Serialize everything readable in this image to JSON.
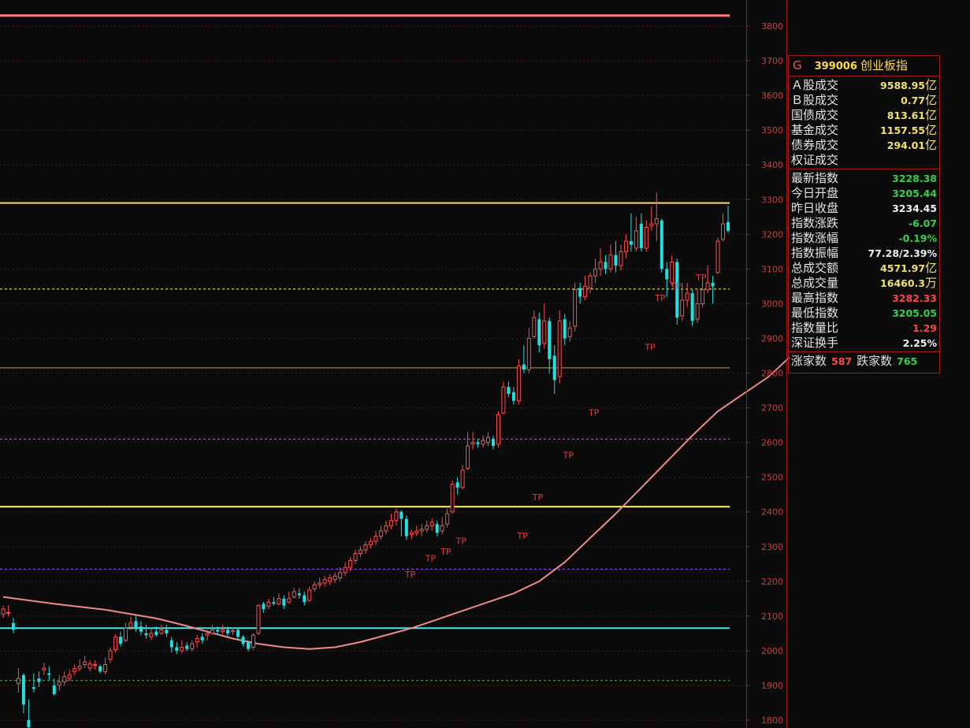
{
  "colors": {
    "up": "#ff4d4d",
    "down": "#20e0e0",
    "ma": "#f08a8a",
    "axis": "#a01818",
    "tp": "#e33b3b"
  },
  "panel": {
    "marker": "G",
    "code": "399006",
    "name": "创业板指",
    "turnover": [
      {
        "label": "Ａ股成交",
        "value": "9588.95",
        "unit": "亿",
        "color": "yel"
      },
      {
        "label": "Ｂ股成交",
        "value": "0.77",
        "unit": "亿",
        "color": "yel"
      },
      {
        "label": "国债成交",
        "value": "813.61",
        "unit": "亿",
        "color": "yel"
      },
      {
        "label": "基金成交",
        "value": "1157.55",
        "unit": "亿",
        "color": "yel"
      },
      {
        "label": "债券成交",
        "value": "294.01",
        "unit": "亿",
        "color": "yel"
      },
      {
        "label": "权证成交",
        "value": "",
        "unit": "",
        "color": "yel"
      }
    ],
    "quote": [
      {
        "label": "最新指数",
        "value": "3228.38",
        "unit": "",
        "color": "grn"
      },
      {
        "label": "今日开盘",
        "value": "3205.44",
        "unit": "",
        "color": "grn"
      },
      {
        "label": "昨日收盘",
        "value": "3234.45",
        "unit": "",
        "color": "wht"
      },
      {
        "label": "指数涨跌",
        "value": "-6.07",
        "unit": "",
        "color": "grn"
      },
      {
        "label": "指数涨幅",
        "value": "-0.19%",
        "unit": "",
        "color": "grn"
      },
      {
        "label": "指数振幅",
        "value": "77.28/2.39%",
        "unit": "",
        "color": "wht"
      },
      {
        "label": "总成交额",
        "value": "4571.97",
        "unit": "亿",
        "color": "yel"
      },
      {
        "label": "总成交量",
        "value": "16460.3",
        "unit": "万",
        "color": "yel"
      },
      {
        "label": "最高指数",
        "value": "3282.33",
        "unit": "",
        "color": "red"
      },
      {
        "label": "最低指数",
        "value": "3205.05",
        "unit": "",
        "color": "grn"
      },
      {
        "label": "指数量比",
        "value": "1.29",
        "unit": "",
        "color": "red"
      },
      {
        "label": "深证换手",
        "value": "2.25%",
        "unit": "",
        "color": "wht"
      }
    ],
    "counts": {
      "up_label": "涨家数",
      "up": "587",
      "down_label": "跌家数",
      "down": "765"
    }
  },
  "chart_data": {
    "type": "candlestick",
    "title": "",
    "ylim": [
      1780,
      3850
    ],
    "y_ticks": [
      "3800",
      "3700",
      "3600",
      "3500",
      "3400",
      "3300",
      "3200",
      "3100",
      "3000",
      "2900",
      "2800",
      "2700",
      "2600",
      "2500",
      "2400",
      "2300",
      "2200",
      "2100",
      "2000",
      "1900",
      "1800"
    ],
    "reference_lines": [
      {
        "value": 3830,
        "color": "#ff7a7a",
        "style": "solid",
        "width": 3
      },
      {
        "value": 3290,
        "color": "#ffd27a",
        "style": "solid",
        "width": 2
      },
      {
        "value": 3042,
        "color": "#ffff66",
        "style": "dashed",
        "width": 1
      },
      {
        "value": 2815,
        "color": "#b8a040",
        "style": "solid",
        "width": 1
      },
      {
        "value": 2610,
        "color": "#ff44ff",
        "style": "dashed",
        "width": 1
      },
      {
        "value": 2415,
        "color": "#ffee66",
        "style": "solid",
        "width": 2
      },
      {
        "value": 2235,
        "color": "#a855ff",
        "style": "dashed",
        "width": 1
      },
      {
        "value": 2065,
        "color": "#40e8e8",
        "style": "solid",
        "width": 2
      },
      {
        "value": 1914,
        "color": "#33cc33",
        "style": "dashed",
        "width": 1
      }
    ],
    "tp_label": "TP",
    "tp_marks": [
      {
        "index": 79,
        "price": 2234
      },
      {
        "index": 83,
        "price": 2280
      },
      {
        "index": 86,
        "price": 2300
      },
      {
        "index": 89,
        "price": 2330
      },
      {
        "index": 101,
        "price": 2345
      },
      {
        "index": 104,
        "price": 2456
      },
      {
        "index": 110,
        "price": 2577
      },
      {
        "index": 115,
        "price": 2700
      },
      {
        "index": 126,
        "price": 2888
      },
      {
        "index": 128,
        "price": 3030
      },
      {
        "index": 131,
        "price": 3065
      },
      {
        "index": 136,
        "price": 3090
      }
    ],
    "ma_points": [
      [
        0,
        2155
      ],
      [
        10,
        2135
      ],
      [
        20,
        2118
      ],
      [
        30,
        2093
      ],
      [
        35,
        2075
      ],
      [
        40,
        2055
      ],
      [
        45,
        2035
      ],
      [
        50,
        2020
      ],
      [
        55,
        2010
      ],
      [
        60,
        2005
      ],
      [
        65,
        2010
      ],
      [
        70,
        2025
      ],
      [
        75,
        2045
      ],
      [
        80,
        2065
      ],
      [
        85,
        2090
      ],
      [
        90,
        2115
      ],
      [
        95,
        2140
      ],
      [
        100,
        2165
      ],
      [
        105,
        2200
      ],
      [
        110,
        2255
      ],
      [
        115,
        2325
      ],
      [
        120,
        2395
      ],
      [
        125,
        2470
      ],
      [
        130,
        2545
      ],
      [
        135,
        2620
      ],
      [
        140,
        2690
      ],
      [
        145,
        2740
      ],
      [
        150,
        2790
      ],
      [
        154,
        2845
      ]
    ],
    "candles": [
      [
        2105,
        2120,
        2130,
        2095
      ],
      [
        2110,
        2110,
        2130,
        2100
      ],
      [
        2080,
        2060,
        2095,
        2050
      ],
      [
        1905,
        1920,
        1950,
        1880
      ],
      [
        1930,
        1845,
        1935,
        1820
      ],
      [
        1800,
        1780,
        1860,
        1770
      ],
      [
        1895,
        1890,
        1935,
        1880
      ],
      [
        1920,
        1910,
        1940,
        1895
      ],
      [
        1945,
        1950,
        1965,
        1930
      ],
      [
        1935,
        1930,
        1955,
        1915
      ],
      [
        1900,
        1875,
        1920,
        1870
      ],
      [
        1900,
        1910,
        1930,
        1885
      ],
      [
        1910,
        1925,
        1940,
        1900
      ],
      [
        1920,
        1930,
        1945,
        1910
      ],
      [
        1940,
        1948,
        1960,
        1930
      ],
      [
        1948,
        1955,
        1975,
        1940
      ],
      [
        1960,
        1968,
        1985,
        1950
      ],
      [
        1950,
        1962,
        1972,
        1940
      ],
      [
        1958,
        1960,
        1972,
        1945
      ],
      [
        1955,
        1940,
        1960,
        1935
      ],
      [
        1940,
        1960,
        1980,
        1932
      ],
      [
        1975,
        2000,
        2010,
        1965
      ],
      [
        2003,
        2040,
        2048,
        1995
      ],
      [
        2040,
        2020,
        2055,
        2012
      ],
      [
        2030,
        2065,
        2080,
        2025
      ],
      [
        2068,
        2080,
        2098,
        2060
      ],
      [
        2085,
        2065,
        2100,
        2055
      ],
      [
        2070,
        2055,
        2085,
        2045
      ],
      [
        2050,
        2045,
        2075,
        2035
      ],
      [
        2040,
        2050,
        2065,
        2030
      ],
      [
        2055,
        2045,
        2070,
        2040
      ],
      [
        2050,
        2060,
        2075,
        2045
      ],
      [
        2060,
        2050,
        2075,
        2040
      ],
      [
        2030,
        2010,
        2040,
        1995
      ],
      [
        2010,
        2000,
        2025,
        1990
      ],
      [
        2000,
        2010,
        2030,
        1992
      ],
      [
        2015,
        2005,
        2025,
        1998
      ],
      [
        2005,
        2020,
        2030,
        1998
      ],
      [
        2025,
        2035,
        2045,
        2010
      ],
      [
        2040,
        2030,
        2050,
        2020
      ],
      [
        2045,
        2050,
        2060,
        2030
      ],
      [
        2050,
        2060,
        2075,
        2045
      ],
      [
        2060,
        2055,
        2070,
        2045
      ],
      [
        2055,
        2060,
        2075,
        2048
      ],
      [
        2060,
        2050,
        2070,
        2040
      ],
      [
        2055,
        2058,
        2068,
        2045
      ],
      [
        2060,
        2040,
        2065,
        2030
      ],
      [
        2040,
        2020,
        2045,
        2012
      ],
      [
        2025,
        2005,
        2030,
        1998
      ],
      [
        2010,
        2045,
        2050,
        2002
      ],
      [
        2050,
        2130,
        2135,
        2045
      ],
      [
        2135,
        2120,
        2140,
        2110
      ],
      [
        2128,
        2140,
        2150,
        2120
      ],
      [
        2140,
        2135,
        2155,
        2130
      ],
      [
        2135,
        2150,
        2165,
        2130
      ],
      [
        2150,
        2130,
        2160,
        2120
      ],
      [
        2140,
        2150,
        2170,
        2135
      ],
      [
        2155,
        2170,
        2180,
        2150
      ],
      [
        2165,
        2160,
        2180,
        2150
      ],
      [
        2160,
        2140,
        2170,
        2130
      ],
      [
        2145,
        2175,
        2185,
        2140
      ],
      [
        2178,
        2190,
        2200,
        2170
      ],
      [
        2190,
        2195,
        2210,
        2180
      ],
      [
        2195,
        2205,
        2215,
        2185
      ],
      [
        2200,
        2210,
        2220,
        2190
      ],
      [
        2205,
        2215,
        2225,
        2195
      ],
      [
        2210,
        2225,
        2240,
        2200
      ],
      [
        2225,
        2240,
        2255,
        2215
      ],
      [
        2240,
        2260,
        2270,
        2230
      ],
      [
        2260,
        2280,
        2290,
        2250
      ],
      [
        2280,
        2290,
        2300,
        2270
      ],
      [
        2290,
        2305,
        2315,
        2280
      ],
      [
        2305,
        2315,
        2325,
        2295
      ],
      [
        2315,
        2330,
        2345,
        2305
      ],
      [
        2330,
        2345,
        2360,
        2320
      ],
      [
        2345,
        2360,
        2375,
        2335
      ],
      [
        2360,
        2375,
        2395,
        2350
      ],
      [
        2375,
        2400,
        2410,
        2360
      ],
      [
        2400,
        2380,
        2405,
        2330
      ],
      [
        2380,
        2330,
        2390,
        2320
      ],
      [
        2335,
        2340,
        2350,
        2320
      ],
      [
        2340,
        2345,
        2360,
        2330
      ],
      [
        2345,
        2350,
        2365,
        2330
      ],
      [
        2350,
        2360,
        2375,
        2340
      ],
      [
        2360,
        2370,
        2380,
        2345
      ],
      [
        2365,
        2340,
        2375,
        2330
      ],
      [
        2345,
        2360,
        2385,
        2335
      ],
      [
        2365,
        2395,
        2410,
        2355
      ],
      [
        2400,
        2480,
        2490,
        2395
      ],
      [
        2485,
        2470,
        2500,
        2450
      ],
      [
        2470,
        2520,
        2535,
        2465
      ],
      [
        2525,
        2590,
        2630,
        2520
      ],
      [
        2595,
        2600,
        2630,
        2580
      ],
      [
        2600,
        2595,
        2610,
        2585
      ],
      [
        2595,
        2605,
        2620,
        2585
      ],
      [
        2600,
        2615,
        2630,
        2590
      ],
      [
        2610,
        2590,
        2620,
        2580
      ],
      [
        2595,
        2680,
        2690,
        2585
      ],
      [
        2685,
        2760,
        2775,
        2680
      ],
      [
        2760,
        2740,
        2775,
        2730
      ],
      [
        2745,
        2720,
        2760,
        2710
      ],
      [
        2720,
        2820,
        2840,
        2710
      ],
      [
        2825,
        2810,
        2880,
        2800
      ],
      [
        2810,
        2900,
        2930,
        2800
      ],
      [
        2905,
        2960,
        2980,
        2900
      ],
      [
        2955,
        2880,
        2975,
        2860
      ],
      [
        2885,
        2950,
        3000,
        2870
      ],
      [
        2950,
        2840,
        2960,
        2800
      ],
      [
        2850,
        2780,
        2880,
        2740
      ],
      [
        2790,
        2950,
        2980,
        2770
      ],
      [
        2955,
        2900,
        2970,
        2880
      ],
      [
        2905,
        2930,
        2950,
        2890
      ],
      [
        2935,
        3040,
        3060,
        2920
      ],
      [
        3045,
        3020,
        3060,
        3000
      ],
      [
        3020,
        3050,
        3080,
        3010
      ],
      [
        3045,
        3080,
        3090,
        3030
      ],
      [
        3080,
        3100,
        3130,
        3060
      ],
      [
        3100,
        3120,
        3160,
        3080
      ],
      [
        3120,
        3100,
        3140,
        3085
      ],
      [
        3100,
        3140,
        3170,
        3090
      ],
      [
        3140,
        3110,
        3180,
        3090
      ],
      [
        3110,
        3150,
        3170,
        3095
      ],
      [
        3150,
        3180,
        3200,
        3130
      ],
      [
        3180,
        3170,
        3260,
        3150
      ],
      [
        3160,
        3210,
        3250,
        3150
      ],
      [
        3230,
        3160,
        3260,
        3150
      ],
      [
        3160,
        3220,
        3240,
        3150
      ],
      [
        3225,
        3230,
        3280,
        3210
      ],
      [
        3230,
        3245,
        3320,
        3180
      ],
      [
        3240,
        3100,
        3245,
        3090
      ],
      [
        3100,
        3070,
        3120,
        3020
      ],
      [
        3060,
        3120,
        3140,
        3050
      ],
      [
        3120,
        2960,
        3130,
        2940
      ],
      [
        2965,
        3010,
        3060,
        2950
      ],
      [
        3010,
        3030,
        3060,
        2990
      ],
      [
        3030,
        2950,
        3040,
        2935
      ],
      [
        2955,
        3000,
        3040,
        2945
      ],
      [
        3000,
        3040,
        3070,
        2990
      ],
      [
        3040,
        3060,
        3110,
        3030
      ],
      [
        3060,
        3050,
        3080,
        3000
      ],
      [
        3090,
        3180,
        3190,
        3085
      ],
      [
        3185,
        3230,
        3260,
        3180
      ],
      [
        3235,
        3210,
        3282,
        3205
      ]
    ]
  }
}
